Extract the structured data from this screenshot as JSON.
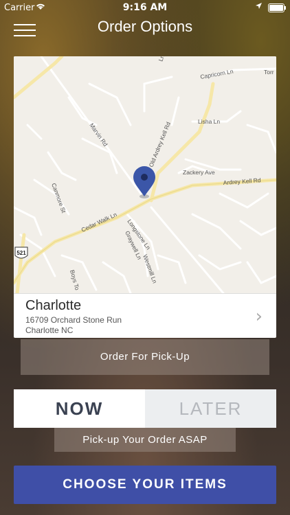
{
  "status_bar": {
    "carrier": "Carrier",
    "time": "9:16 AM"
  },
  "nav": {
    "title": "Order Options"
  },
  "map": {
    "labels": {
      "capricorn": "Capricorn Ln",
      "lisha": "Lisha Ln",
      "marvin": "Marvin Rd",
      "old_ardrey": "Old Ardrey Kell Rd",
      "zackery": "Zackery Ave",
      "ardrey": "Ardrey Kell Rd",
      "canmore": "Canmore St",
      "cedar": "Cedar Walk Ln",
      "longstone": "Longstone Ln",
      "graywell": "Graywell Ln",
      "westmill": "Westmill Ln",
      "boys": "Boys To",
      "shield": "521",
      "ln_top": "Ln",
      "torr": "Torr"
    }
  },
  "location": {
    "name": "Charlotte",
    "address": "16709 Orchard Stone Run",
    "city": "Charlotte NC"
  },
  "pickup": {
    "label": "Order For Pick-Up"
  },
  "toggle": {
    "now": "NOW",
    "later": "LATER",
    "selected": "now"
  },
  "asap": {
    "label": "Pick-up Your Order ASAP"
  },
  "cta": {
    "label": "CHOOSE YOUR ITEMS"
  },
  "colors": {
    "cta": "#3f4fa7",
    "pin": "#3b56a8",
    "map_bg": "#f2efe9",
    "major_road": "#f6e7a8"
  }
}
